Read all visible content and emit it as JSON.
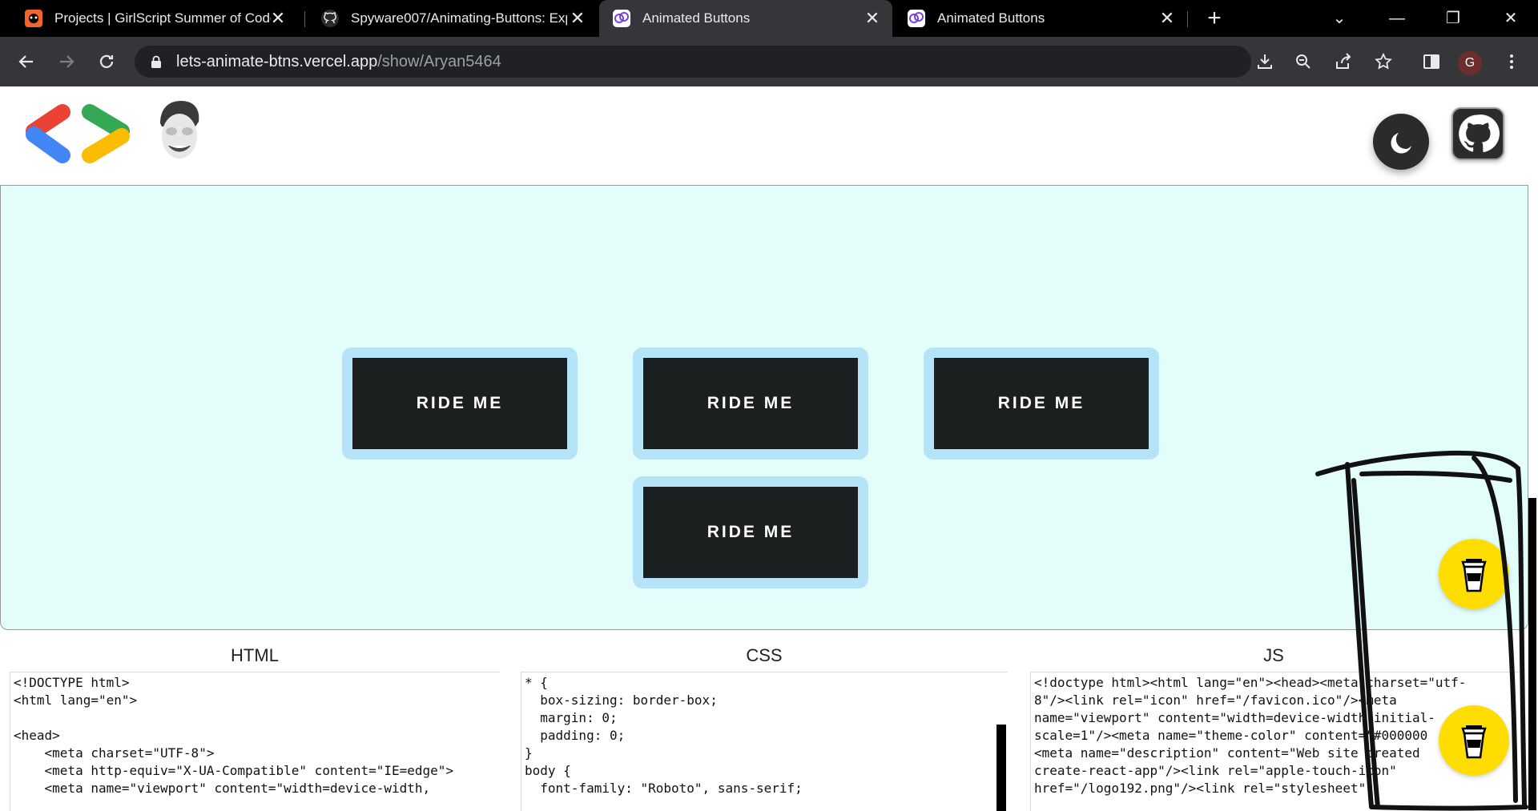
{
  "browser": {
    "tabs": [
      {
        "title": "Projects | GirlScript Summer of Code",
        "icon": "gssoc-icon",
        "active": false
      },
      {
        "title": "Spyware007/Animating-Buttons: Exp",
        "icon": "github-icon",
        "active": false
      },
      {
        "title": "Animated Buttons",
        "icon": "animated-buttons-icon",
        "active": true
      },
      {
        "title": "Animated Buttons",
        "icon": "animated-buttons-icon",
        "active": false
      }
    ],
    "url_domain": "lets-animate-btns.vercel.app",
    "url_path": "/show/Aryan5464",
    "profile_initial": "G"
  },
  "page": {
    "buttons": [
      "RIDE ME",
      "RIDE ME",
      "RIDE ME",
      "RIDE ME"
    ],
    "panels": {
      "html_title": "HTML",
      "css_title": "CSS",
      "js_title": "JS",
      "html_code": "<!DOCTYPE html>\n<html lang=\"en\">\n\n<head>\n    <meta charset=\"UTF-8\">\n    <meta http-equiv=\"X-UA-Compatible\" content=\"IE=edge\">\n    <meta name=\"viewport\" content=\"width=device-width,",
      "css_code": "* {\n  box-sizing: border-box;\n  margin: 0;\n  padding: 0;\n}\nbody {\n  font-family: \"Roboto\", sans-serif;",
      "js_code": "<!doctype html><html lang=\"en\"><head><meta charset=\"utf-\n8\"/><link rel=\"icon\" href=\"/favicon.ico\"/><meta\nname=\"viewport\" content=\"width=device-width,initial-\nscale=1\"/><meta name=\"theme-color\" content=\"#000000\n<meta name=\"description\" content=\"Web site created\ncreate-react-app\"/><link rel=\"apple-touch-icon\"\nhref=\"/logo192.png\"/><link rel=\"stylesheet\""
    }
  },
  "colors": {
    "stage_bg": "#e3fdfa",
    "button_bg": "#1c1f20",
    "button_border": "#b5e3f8",
    "coffee_button": "#ffdd00"
  }
}
